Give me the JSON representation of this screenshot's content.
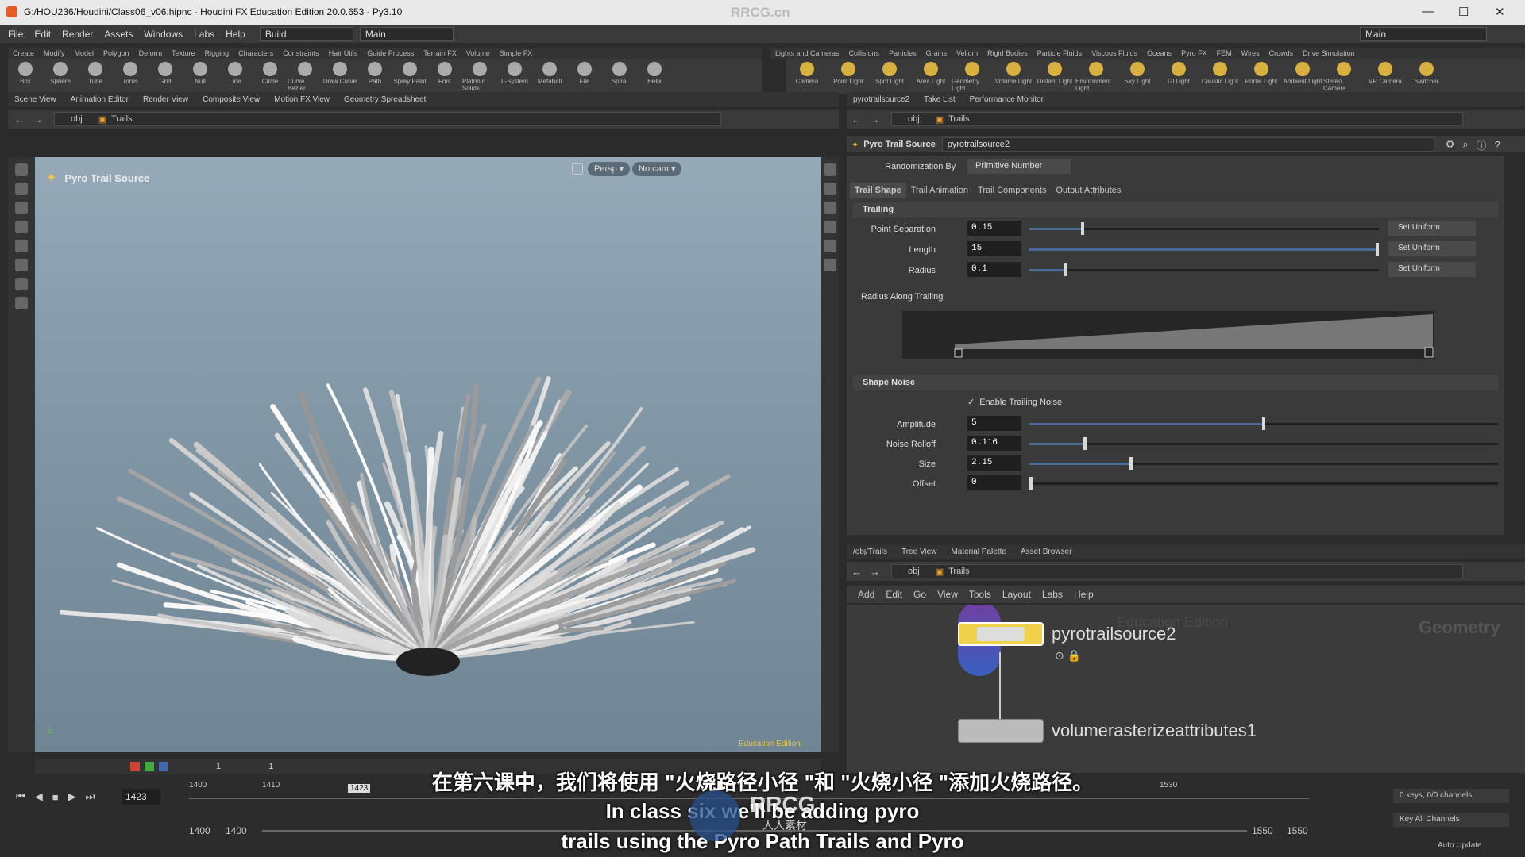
{
  "titlebar": {
    "title": "G:/HOU236/Houdini/Class06_v06.hipnc - Houdini FX Education Edition 20.0.653 - Py3.10",
    "watermark": "RRCG.cn"
  },
  "menubar": {
    "items": [
      "File",
      "Edit",
      "Render",
      "Assets",
      "Windows",
      "Labs",
      "Help"
    ],
    "build": "Build",
    "desktop": "Main",
    "right_desktop": "Main"
  },
  "shelf_left": {
    "tabs": [
      "Create",
      "Modify",
      "Model",
      "Polygon",
      "Deform",
      "Texture",
      "Rigging",
      "Characters",
      "Constraints",
      "Hair Utils",
      "Guide Process",
      "Terrain FX",
      "Volume",
      "Simple FX"
    ],
    "tools": [
      "Box",
      "Sphere",
      "Tube",
      "Torus",
      "Grid",
      "Null",
      "Line",
      "Circle",
      "Curve Bezier",
      "Draw Curve",
      "Path",
      "Spray Paint",
      "Font",
      "Platonic Solids",
      "L-System",
      "Metaball",
      "File",
      "Spiral",
      "Helix"
    ]
  },
  "shelf_right": {
    "tabs": [
      "Lights and Cameras",
      "Collisions",
      "Particles",
      "Grains",
      "Vellum",
      "Rigid Bodies",
      "Particle Fluids",
      "Viscous Fluids",
      "Oceans",
      "Pyro FX",
      "FEM",
      "Wires",
      "Crowds",
      "Drive Simulation"
    ],
    "tools": [
      "Camera",
      "Point Light",
      "Spot Light",
      "Area Light",
      "Geometry Light",
      "Volume Light",
      "Distant Light",
      "Environment Light",
      "Sky Light",
      "GI Light",
      "Caustic Light",
      "Portal Light",
      "Ambient Light",
      "Stereo Camera",
      "VR Camera",
      "Switcher"
    ]
  },
  "viewer": {
    "tabs": [
      "Scene View",
      "Animation Editor",
      "Render View",
      "Composite View",
      "Motion FX View",
      "Geometry Spreadsheet"
    ],
    "path_obj": "obj",
    "path_node": "Trails",
    "tool_name": "Pyro Trail Source",
    "persp": "Persp ▾",
    "cam": "No cam ▾",
    "edu": "Education Edition"
  },
  "params_pane": {
    "tabs": [
      "pyrotrailsource2",
      "Take List",
      "Performance Monitor"
    ],
    "path_obj": "obj",
    "path_node": "Trails",
    "node_type": "Pyro Trail Source",
    "node_name": "pyrotrailsource2",
    "randomization_label": "Randomization By",
    "randomization_value": "Primitive Number",
    "param_tabs": [
      "Trail Shape",
      "Trail Animation",
      "Trail Components",
      "Output Attributes"
    ],
    "trailing": {
      "title": "Trailing",
      "point_separation": {
        "label": "Point Separation",
        "value": "0.15",
        "frac": 0.15,
        "btn": "Set Uniform"
      },
      "length": {
        "label": "Length",
        "value": "15",
        "frac": 1.0,
        "btn": "Set Uniform"
      },
      "radius": {
        "label": "Radius",
        "value": "0.1",
        "frac": 0.1,
        "btn": "Set Uniform"
      },
      "ramp_label": "Radius Along Trailing"
    },
    "shape_noise": {
      "title": "Shape Noise",
      "enable": "Enable Trailing Noise",
      "amplitude": {
        "label": "Amplitude",
        "value": "5",
        "frac": 0.5
      },
      "noise_rolloff": {
        "label": "Noise Rolloff",
        "value": "0.116",
        "frac": 0.116
      },
      "size": {
        "label": "Size",
        "value": "2.15",
        "frac": 0.215
      },
      "offset": {
        "label": "Offset",
        "value": "0",
        "frac": 0.0
      }
    }
  },
  "network": {
    "tabs": [
      "/obj/Trails",
      "Tree View",
      "Material Palette",
      "Asset Browser"
    ],
    "path_obj": "obj",
    "path_node": "Trails",
    "menu": [
      "Add",
      "Edit",
      "Go",
      "View",
      "Tools",
      "Layout",
      "Labs",
      "Help"
    ],
    "edu": "Education Edition",
    "context": "Geometry",
    "nodes": [
      "pyrotrailsource2",
      "volumerasterizeattributes1"
    ]
  },
  "timeline": {
    "frame": "1423",
    "marker": "1423",
    "ticks": [
      "1400",
      "1410",
      "1530"
    ],
    "start": "1400",
    "start2": "1400",
    "end": "1550",
    "end2": "1550",
    "keys": "0 keys, 0/0 channels",
    "key_all": "Key All Channels",
    "auto_update": "Auto Update",
    "spin": "1",
    "spin2": "1"
  },
  "subtitles": {
    "cn": "在第六课中，我们将使用 \"火烧路径小径 \"和 \"火烧小径 \"添加火烧路径。",
    "en1": "In class six we'll be adding pyro",
    "en2": "trails using the Pyro Path Trails and Pyro",
    "logo": "RRCG",
    "logo_cn": "人人素材"
  },
  "colors": {
    "accent": "#4a6b9a",
    "viewport_top": "#95a9b7",
    "node_selected": "#f0d24a"
  }
}
